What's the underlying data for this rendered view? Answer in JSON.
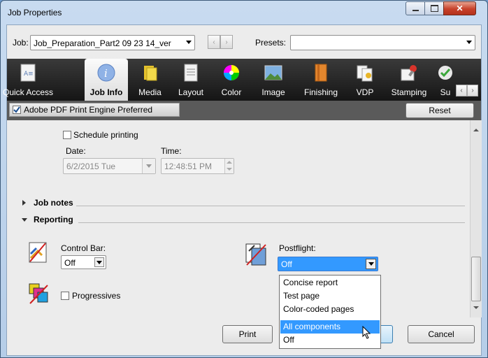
{
  "window": {
    "title": "Job Properties"
  },
  "toprow": {
    "job_label": "Job:",
    "job_value": "Job_Preparation_Part2 09 23 14_ver",
    "presets_label": "Presets:",
    "presets_value": ""
  },
  "ribbon": {
    "tabs": [
      {
        "label": "Quick Access",
        "icon": "quick-access-icon"
      },
      {
        "label": "Job Info",
        "icon": "info-icon",
        "selected": true
      },
      {
        "label": "Media",
        "icon": "media-icon"
      },
      {
        "label": "Layout",
        "icon": "layout-icon"
      },
      {
        "label": "Color",
        "icon": "color-wheel-icon"
      },
      {
        "label": "Image",
        "icon": "image-icon"
      },
      {
        "label": "Finishing",
        "icon": "finishing-icon"
      },
      {
        "label": "VDP",
        "icon": "vdp-icon"
      },
      {
        "label": "Stamping",
        "icon": "stamping-icon"
      },
      {
        "label": "Su",
        "icon": "check-icon"
      }
    ]
  },
  "subbar": {
    "pdf_engine_label": "Adobe PDF Print Engine Preferred",
    "pdf_engine_checked": true,
    "reset_label": "Reset"
  },
  "schedule": {
    "checkbox_label": "Schedule printing",
    "date_label": "Date:",
    "date_value": "6/2/2015 Tue",
    "time_label": "Time:",
    "time_value": "12:48:51 PM"
  },
  "sections": {
    "job_notes": "Job notes",
    "reporting": "Reporting"
  },
  "reporting": {
    "control_bar_label": "Control Bar:",
    "control_bar_value": "Off",
    "progressives_label": "Progressives",
    "postflight_label": "Postflight:",
    "postflight_value": "Off",
    "postflight_options": [
      "Concise report",
      "Test page",
      "Color-coded pages",
      "All components",
      "Off"
    ],
    "highlighted_option": "All components"
  },
  "footer": {
    "print_label": "Print",
    "cancel_label": "Cancel"
  },
  "colors": {
    "accent": "#3399ff",
    "ribbon": "#1e1e1e",
    "subbar": "#5a5a5a"
  }
}
